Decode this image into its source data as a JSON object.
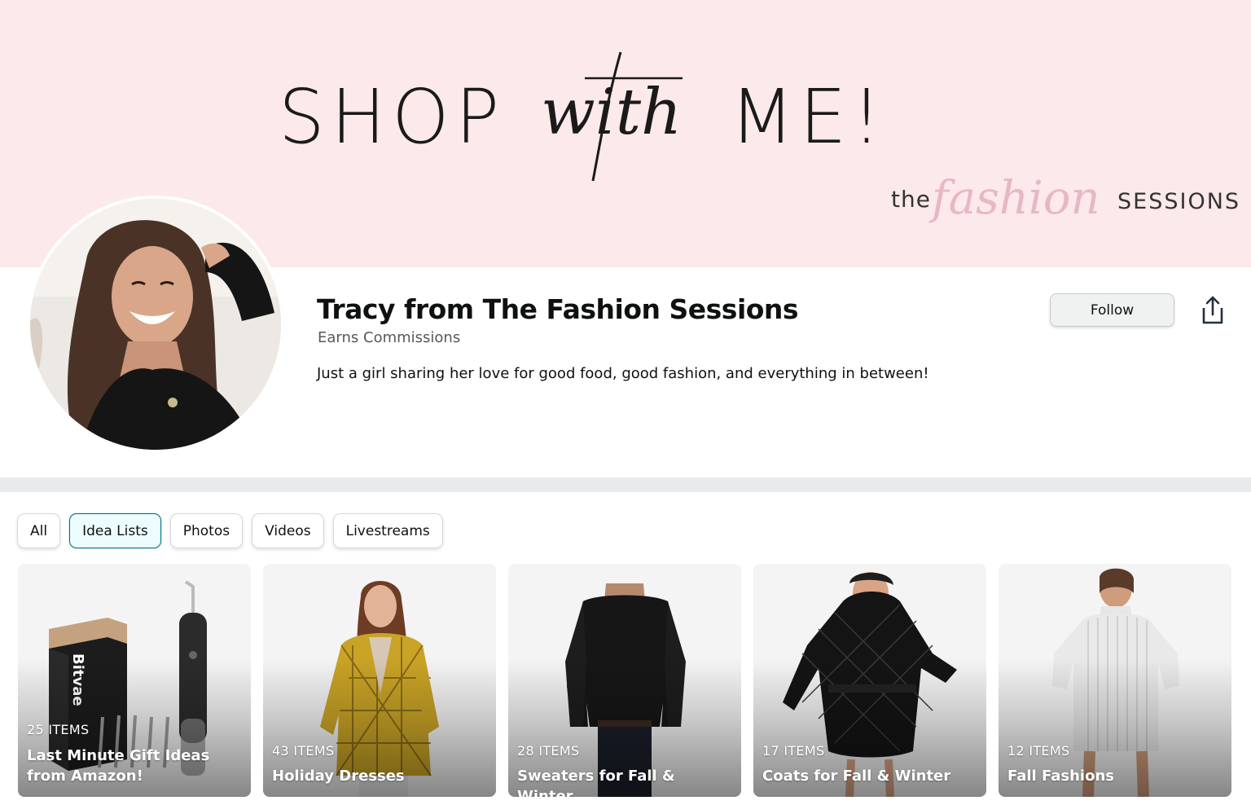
{
  "banner": {
    "shop": "SHOP",
    "with": "with",
    "me": "ME!",
    "brand_the": "the",
    "brand_script": "fashion",
    "brand_sessions": "SESSIONS"
  },
  "profile": {
    "name": "Tracy from The Fashion Sessions",
    "earns": "Earns Commissions",
    "bio": "Just a girl sharing her love for good food, good fashion, and everything in between!",
    "follow_label": "Follow",
    "share_icon": "share-icon"
  },
  "tabs": [
    {
      "label": "All",
      "active": false
    },
    {
      "label": "Idea Lists",
      "active": true
    },
    {
      "label": "Photos",
      "active": false
    },
    {
      "label": "Videos",
      "active": false
    },
    {
      "label": "Livestreams",
      "active": false
    }
  ],
  "cards": [
    {
      "count": "25 ITEMS",
      "title": "Last Minute Gift Ideas from Amazon!",
      "image": "water-flosser"
    },
    {
      "count": "43 ITEMS",
      "title": "Holiday Dresses",
      "image": "plaid-blazer"
    },
    {
      "count": "28 ITEMS",
      "title": "Sweaters for Fall & Winter",
      "image": "black-sweater"
    },
    {
      "count": "17 ITEMS",
      "title": "Coats for Fall & Winter",
      "image": "quilted-coat"
    },
    {
      "count": "12 ITEMS",
      "title": "Fall Fashions",
      "image": "sweater-dress"
    }
  ],
  "colors": {
    "banner_bg": "#fce9ea",
    "accent": "#007185",
    "active_tab_bg": "#edfdff",
    "divider": "#e8ebed"
  }
}
